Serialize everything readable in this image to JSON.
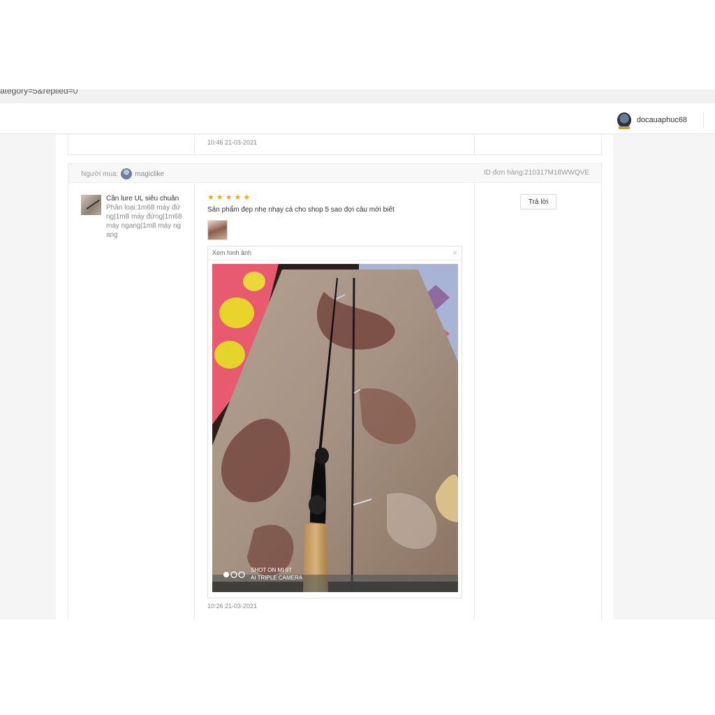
{
  "browser": {
    "url_fragment": "ategory=5&replied=0"
  },
  "header": {
    "username": "docauaphuc68",
    "avatar_icon": "user-avatar-icon"
  },
  "previous_review": {
    "timestamp": "10:46 21-03-2021"
  },
  "review": {
    "buyer_label": "Người mua:",
    "buyer_name": "magiclike",
    "order_id": "ID đơn hàng:210317M18WWQVE",
    "product_name": "Cần lure UL siêu chuân",
    "product_variant": "Phân loại:1m68 máy đứng|1m8 máy đứng|1m68 máy ngang|1m8 máy ngang",
    "rating": 5,
    "comment": "Sản phẩm đẹp nhẹ nhạy cá cho shop 5 sao đợi câu mới biết",
    "image_viewer": {
      "title": "Xem hình ảnh",
      "close_icon": "close-icon",
      "watermark_line1": "SHOT ON MI 9T",
      "watermark_line2": "AI TRIPLE CAMERA"
    },
    "timestamp": "10:26 21-03-2021",
    "reply_label": "Trả lời"
  },
  "colors": {
    "star": "#f6a700",
    "page_background": "#f5f5f5",
    "border": "#e8e8e8"
  }
}
